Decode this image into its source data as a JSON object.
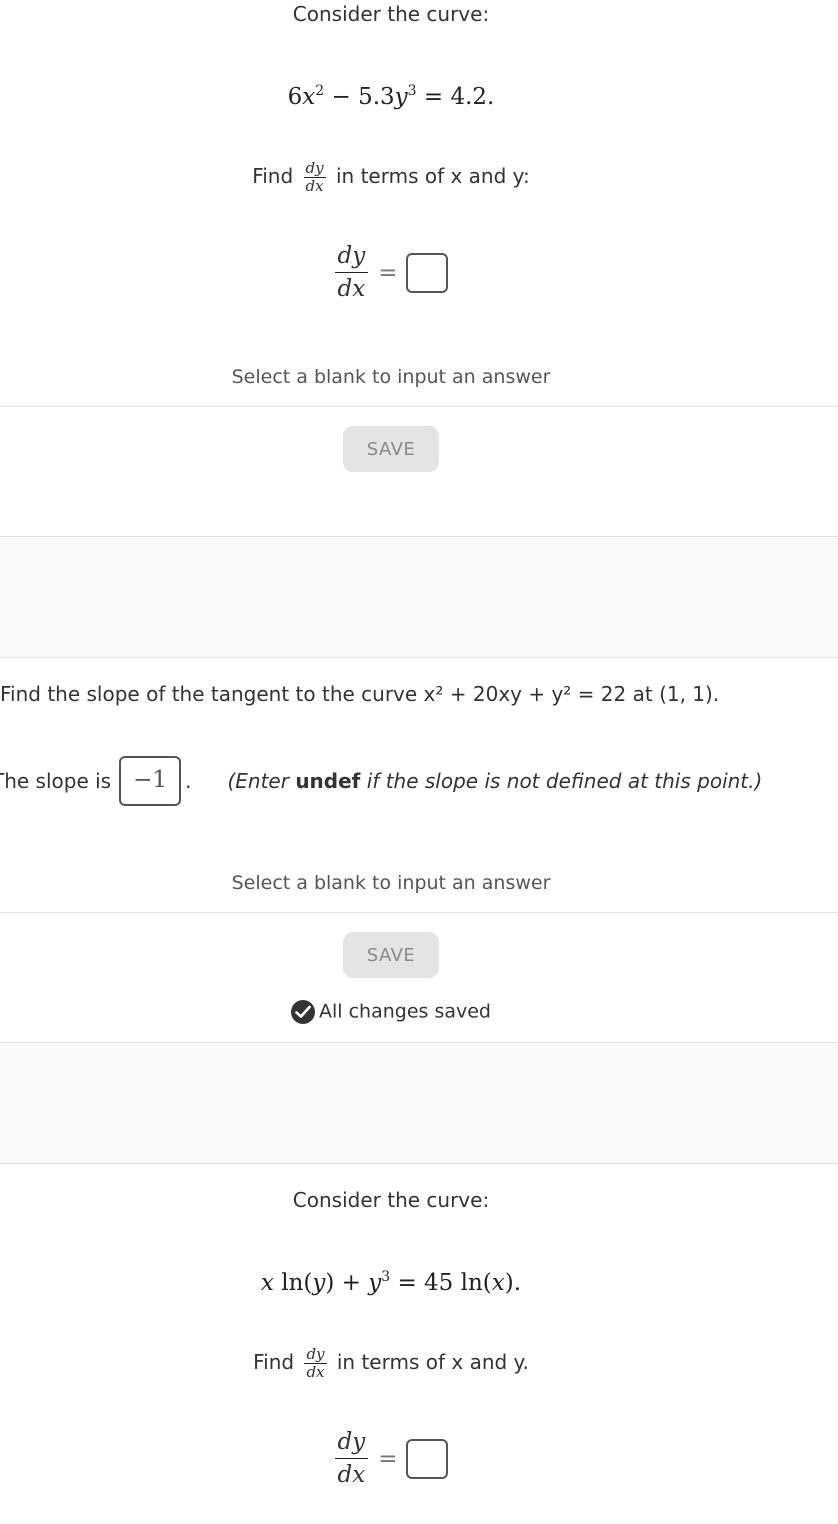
{
  "q1": {
    "intro": "Consider the curve:",
    "find_prefix": "Find",
    "find_suffix": "in terms of x and y:",
    "hint": "Select a blank to input an answer",
    "save_label": "SAVE"
  },
  "q2": {
    "question": "Find the slope of the tangent to the curve x² + 20xy + y² = 22 at (1, 1).",
    "slope_prefix": "The slope is",
    "slope_value": "−1",
    "note_pre": "(Enter",
    "note_bold": "undef",
    "note_post": "if the slope is not defined at this point.)",
    "hint": "Select a blank to input an answer",
    "save_label": "SAVE",
    "saved_status": "All changes saved"
  },
  "q3": {
    "intro": "Consider the curve:",
    "find_prefix": "Find",
    "find_suffix": "in terms of x and y."
  }
}
